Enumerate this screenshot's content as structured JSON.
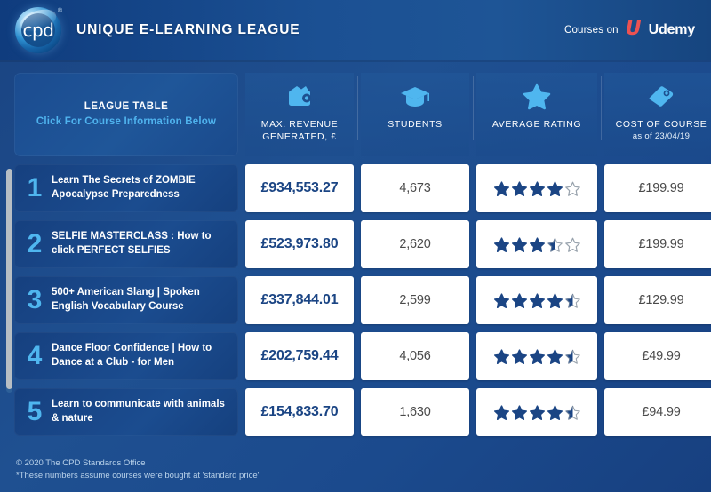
{
  "header": {
    "logo_text": "cpd",
    "logo_registered": "®",
    "brand_title": "UNIQUE E-LEARNING LEAGUE",
    "courses_on_label": "Courses on",
    "udemy_mark": "U",
    "udemy_word": "Udemy"
  },
  "table": {
    "title_line1": "LEAGUE TABLE",
    "title_line2": "Click For Course Information Below",
    "columns": [
      {
        "icon": "wallet-icon",
        "label": "MAX. REVENUE\nGENERATED, £",
        "label_l1": "MAX. REVENUE",
        "label_l2": "GENERATED, £",
        "sub": ""
      },
      {
        "icon": "graduation-cap-icon",
        "label_l1": "STUDENTS",
        "label_l2": "",
        "sub": ""
      },
      {
        "icon": "star-icon",
        "label_l1": "AVERAGE RATING",
        "label_l2": "",
        "sub": ""
      },
      {
        "icon": "price-tag-icon",
        "label_l1": "COST OF COURSE",
        "label_l2": "",
        "sub": "as of 23/04/19"
      }
    ],
    "rows": [
      {
        "rank": "1",
        "course": "Learn The Secrets of ZOMBIE Apocalypse Preparedness",
        "revenue": "£934,553.27",
        "students": "4,673",
        "rating": 4.0,
        "cost": "£199.99"
      },
      {
        "rank": "2",
        "course": "SELFIE MASTERCLASS : How to click PERFECT SELFIES",
        "revenue": "£523,973.80",
        "students": "2,620",
        "rating": 3.5,
        "cost": "£199.99"
      },
      {
        "rank": "3",
        "course": "500+ American Slang | Spoken English Vocabulary Course",
        "revenue": "£337,844.01",
        "students": "2,599",
        "rating": 4.5,
        "cost": "£129.99"
      },
      {
        "rank": "4",
        "course": "Dance Floor Confidence | How to Dance at a Club - for Men",
        "revenue": "£202,759.44",
        "students": "4,056",
        "rating": 4.5,
        "cost": "£49.99"
      },
      {
        "rank": "5",
        "course": "Learn to communicate with animals & nature",
        "revenue": "£154,833.70",
        "students": "1,630",
        "rating": 4.5,
        "cost": "£94.99"
      }
    ]
  },
  "footer": {
    "copyright": "© 2020 The CPD Standards Office",
    "note": "*These numbers assume courses were bought at 'standard price'"
  },
  "colors": {
    "background": "#1c4a8c",
    "accent_light_blue": "#4fb6ef",
    "revenue_text": "#1b4584",
    "star_filled": "#1b4584",
    "star_empty_stroke": "#9aa4ae",
    "udemy_red": "#ec5252",
    "scrollbar_thumb": "#b7bec4"
  }
}
